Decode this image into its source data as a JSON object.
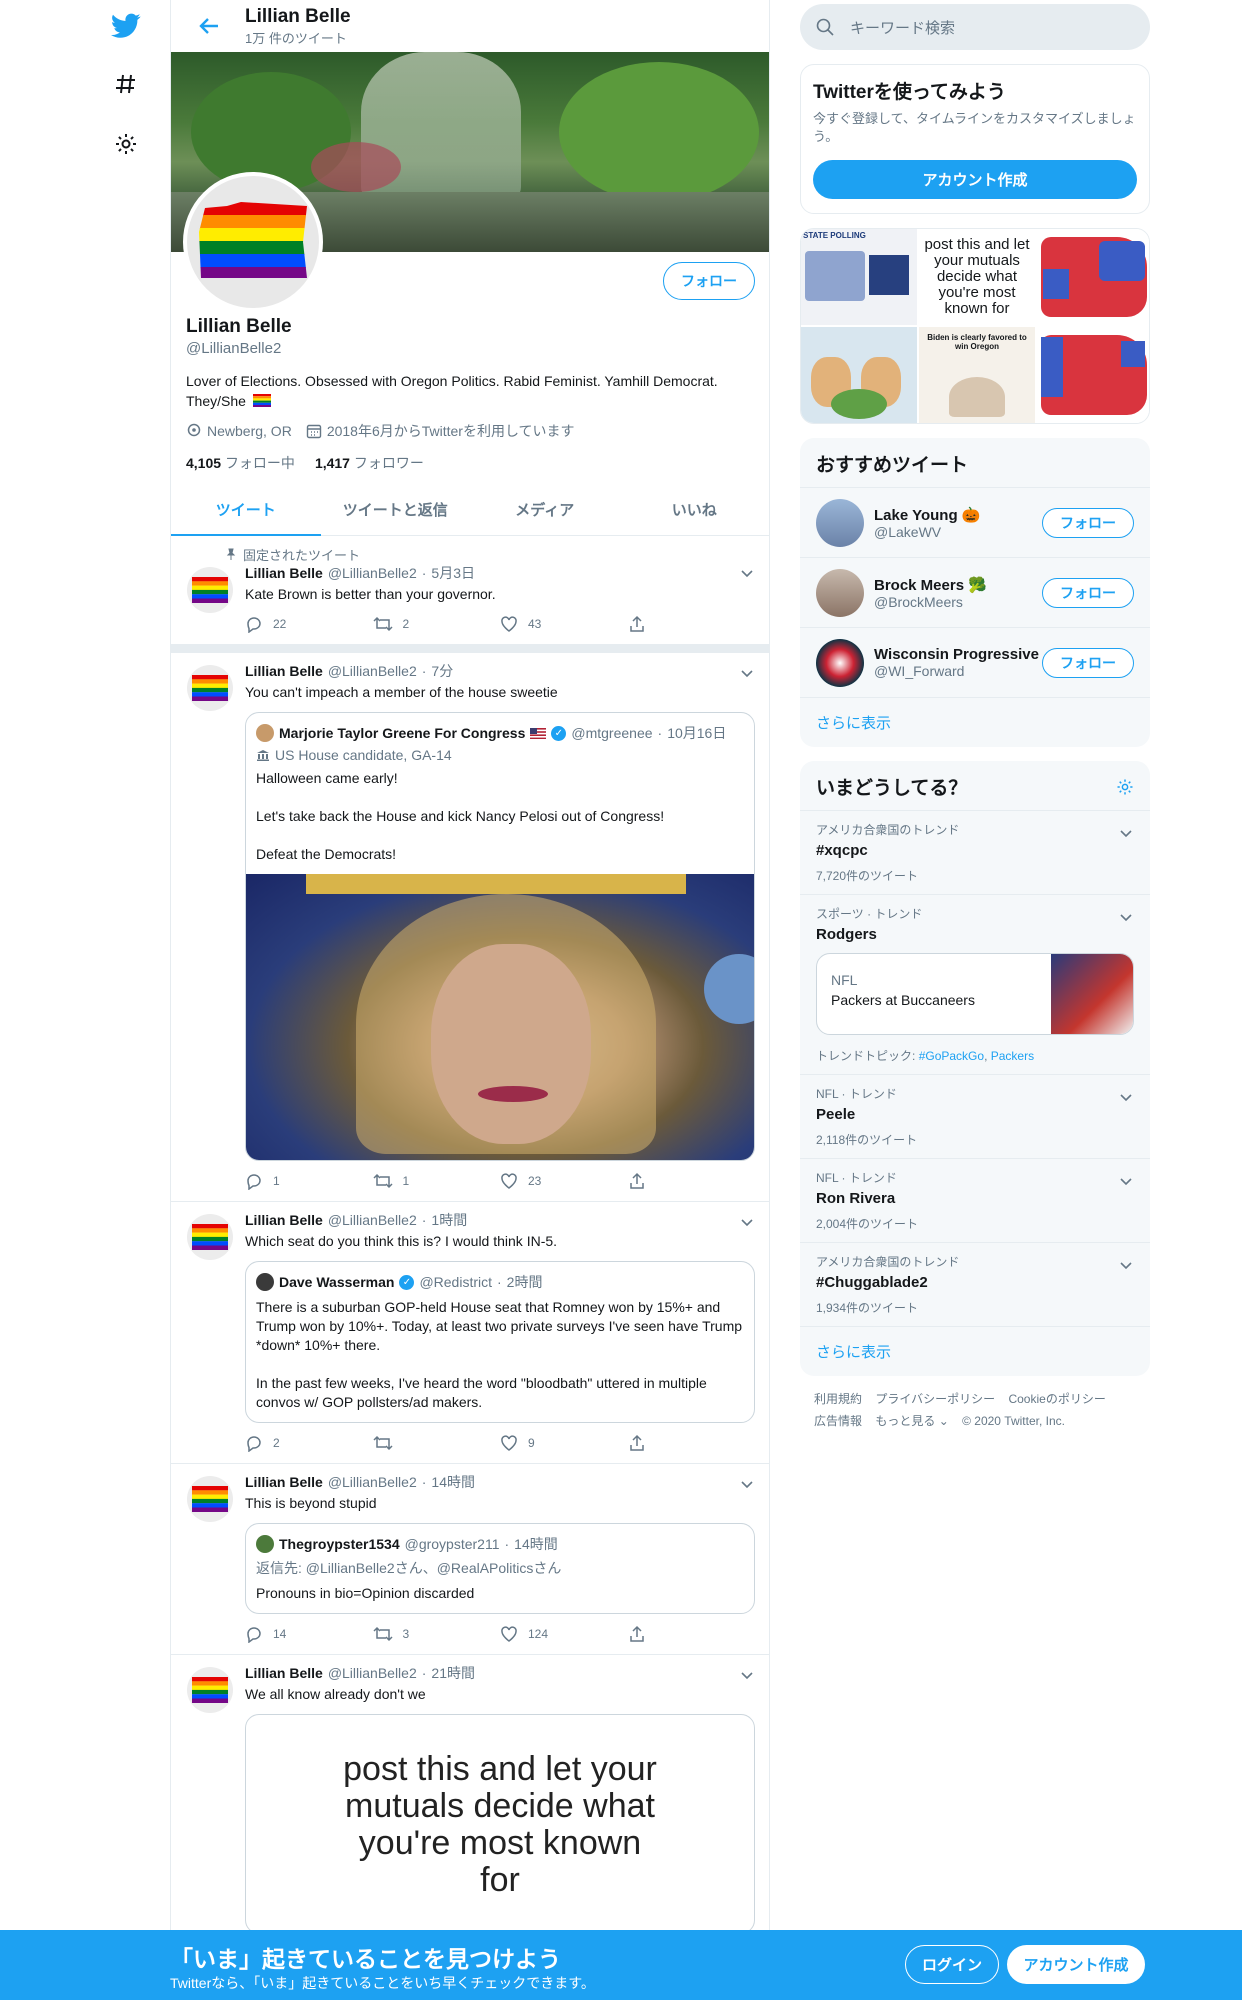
{
  "header": {
    "title": "Lillian Belle",
    "subtitle": "1万 件のツイート"
  },
  "profile": {
    "name": "Lillian Belle",
    "handle": "@LillianBelle2",
    "bio": "Lover of Elections. Obsessed with Oregon Politics. Rabid Feminist. Yamhill Democrat. They/She",
    "location": "Newberg, OR",
    "joined": "2018年6月からTwitterを利用しています",
    "following_count": "4,105",
    "following_label": "フォロー中",
    "followers_count": "1,417",
    "followers_label": "フォロワー",
    "follow_label": "フォロー"
  },
  "tabs": [
    "ツイート",
    "ツイートと返信",
    "メディア",
    "いいね"
  ],
  "tweets": [
    {
      "pinned_label": "固定されたツイート",
      "name": "Lillian Belle",
      "handle": "@LillianBelle2",
      "time": "5月3日",
      "text": "Kate Brown is better than your governor.",
      "replies": "22",
      "retweets": "2",
      "likes": "43"
    },
    {
      "name": "Lillian Belle",
      "handle": "@LillianBelle2",
      "time": "7分",
      "text": "You can't impeach a member of the house sweetie",
      "quote": {
        "name": "Marjorie Taylor Greene For Congress",
        "handle": "@mtgreenee",
        "time": "10月16日",
        "sub": "US House candidate, GA-14",
        "text": "Halloween came early!\n\nLet's take back the House and kick Nancy Pelosi out of Congress!\n\nDefeat the Democrats!"
      },
      "replies": "1",
      "retweets": "1",
      "likes": "23"
    },
    {
      "name": "Lillian Belle",
      "handle": "@LillianBelle2",
      "time": "1時間",
      "text": "Which seat do you think this is? I would think IN-5.",
      "quote": {
        "name": "Dave Wasserman",
        "handle": "@Redistrict",
        "time": "2時間",
        "text": "There is a suburban GOP-held House seat that Romney won by 15%+ and Trump won by 10%+. Today, at least two private surveys I've seen have Trump *down* 10%+ there.\n\nIn the past few weeks, I've heard the word \"bloodbath\" uttered in multiple convos w/ GOP pollsters/ad makers."
      },
      "replies": "2",
      "retweets": "",
      "likes": "9"
    },
    {
      "name": "Lillian Belle",
      "handle": "@LillianBelle2",
      "time": "14時間",
      "text": "This is beyond stupid",
      "quote": {
        "name": "Thegroypster1534",
        "handle": "@groypster211",
        "time": "14時間",
        "sub": "返信先: @LillianBelle2さん、@RealAPoliticsさん",
        "text": "Pronouns in bio=Opinion discarded"
      },
      "replies": "14",
      "retweets": "3",
      "likes": "124"
    },
    {
      "name": "Lillian Belle",
      "handle": "@LillianBelle2",
      "time": "21時間",
      "text": "We all know already don't we",
      "meme": "post this and let your mutuals decide what you're most known for"
    }
  ],
  "search": {
    "placeholder": "キーワード検索"
  },
  "signup_card": {
    "title": "Twitterを使ってみよう",
    "desc": "今すぐ登録して、タイムラインをカスタマイズしましょう。",
    "button": "アカウント作成"
  },
  "media": {
    "poll_label": "STATE POLLING",
    "meme_caption": "post this and let your mutuals decide what you're most known for",
    "biden_caption": "Biden is clearly favored to win Oregon"
  },
  "suggestions": {
    "title": "おすすめツイート",
    "items": [
      {
        "name": "Lake Young 🎃",
        "handle": "@LakeWV",
        "button": "フォロー"
      },
      {
        "name": "Brock Meers 🥦",
        "handle": "@BrockMeers",
        "button": "フォロー"
      },
      {
        "name": "Wisconsin Progressive",
        "handle": "@WI_Forward",
        "button": "フォロー"
      }
    ],
    "more": "さらに表示"
  },
  "trends": {
    "title": "いまどうしてる？",
    "items": [
      {
        "meta": "アメリカ合衆国のトレンド",
        "name": "#xqcpc",
        "count": "7,720件のツイート"
      },
      {
        "meta": "スポーツ · トレンド",
        "name": "Rodgers",
        "card_top": "NFL",
        "card_bottom": "Packers at Buccaneers",
        "topics_label": "トレンドトピック:",
        "topic1": "#GoPackGo",
        "topic2": "Packers"
      },
      {
        "meta": "NFL · トレンド",
        "name": "Peele",
        "count": "2,118件のツイート"
      },
      {
        "meta": "NFL · トレンド",
        "name": "Ron Rivera",
        "count": "2,004件のツイート"
      },
      {
        "meta": "アメリカ合衆国のトレンド",
        "name": "#Chuggablade2",
        "count": "1,934件のツイート"
      }
    ],
    "more": "さらに表示"
  },
  "footer": {
    "links": [
      "利用規約",
      "プライバシーポリシー",
      "Cookieのポリシー",
      "広告情報",
      "もっと見る ⌄"
    ],
    "copyright": "© 2020 Twitter, Inc."
  },
  "bottombar": {
    "title": "「いま」起きていることを見つけよう",
    "subtitle": "Twitterなら、「いま」起きていることをいち早くチェックできます。",
    "login": "ログイン",
    "signup": "アカウント作成"
  },
  "colors": {
    "accent": "#1da1f2",
    "text": "#14171a",
    "secondary": "#657786",
    "border": "#e6ecf0"
  }
}
